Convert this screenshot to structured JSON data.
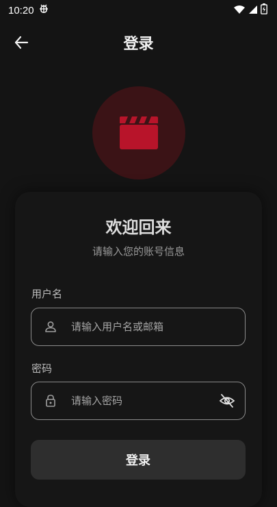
{
  "status_bar": {
    "time": "10:20",
    "icons": [
      "debug-bug-icon",
      "wifi-icon",
      "signal-icon",
      "battery-icon"
    ]
  },
  "app_bar": {
    "title": "登录",
    "back_icon": "arrow-left-icon"
  },
  "logo": {
    "icon": "clapperboard-icon",
    "accent_color": "#b8142a",
    "circle_color": "#3b1316"
  },
  "welcome": {
    "title": "欢迎回来",
    "subtitle": "请输入您的账号信息"
  },
  "form": {
    "username": {
      "label": "用户名",
      "placeholder": "请输入用户名或邮箱",
      "value": "",
      "icon": "person-icon"
    },
    "password": {
      "label": "密码",
      "placeholder": "请输入密码",
      "value": "",
      "icon": "lock-icon",
      "toggle_icon": "eye-off-icon"
    },
    "submit_label": "登录"
  },
  "colors": {
    "background": "#141414",
    "card": "#161616",
    "button": "#2e2e2e",
    "input_border": "#8c8c8c"
  }
}
